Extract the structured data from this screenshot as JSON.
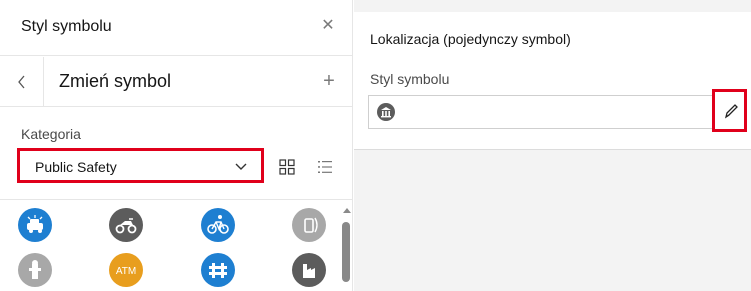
{
  "left_panel": {
    "title": "Styl symbolu",
    "close_icon": "close-icon",
    "subtitle": "Zmień symbol",
    "back_icon": "chevron-left-icon",
    "add_icon": "plus-icon",
    "category_label": "Kategoria",
    "category_value": "Public Safety",
    "view_grid_icon": "grid-view-icon",
    "view_list_icon": "list-view-icon",
    "symbols": [
      {
        "name": "police-car-symbol-icon",
        "color": "#1e7fd1"
      },
      {
        "name": "atv-symbol-icon",
        "color": "#5c5c5c"
      },
      {
        "name": "bicycle-patrol-symbol-icon",
        "color": "#1e7fd1"
      },
      {
        "name": "call-box-symbol-icon",
        "color": "#a8a8a8"
      },
      {
        "name": "fire-hydrant-symbol-icon",
        "color": "#a8a8a8"
      },
      {
        "name": "atm-symbol-icon",
        "color": "#e89e1e",
        "text": "ATM"
      },
      {
        "name": "barrier-symbol-icon",
        "color": "#1e7fd1"
      },
      {
        "name": "building-symbol-icon",
        "color": "#5c5c5c"
      }
    ]
  },
  "right_panel": {
    "section_title": "Lokalizacja (pojedynczy symbol)",
    "field_label": "Styl symbolu",
    "current_symbol_icon": "bank-symbol-icon",
    "edit_icon": "pencil-icon"
  },
  "colors": {
    "highlight": "#e0001b",
    "brand_blue": "#1e7fd1",
    "dark_gray": "#5c5c5c",
    "light_gray": "#a8a8a8",
    "atm_orange": "#e89e1e"
  }
}
